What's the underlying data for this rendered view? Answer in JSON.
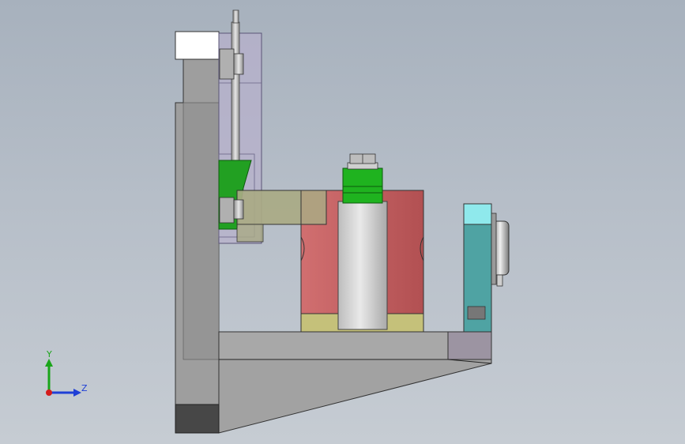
{
  "view": {
    "background_top": "#a7b1bd",
    "background_bottom": "#c6ccd3"
  },
  "triad": {
    "y_label": "Y",
    "z_label": "Z",
    "y_color": "#1aa51a",
    "z_color": "#1f3fd6",
    "x_color": "#d41c1c"
  },
  "parts": {
    "frame_color": "#9e9e9e",
    "plate_color": "#b7b0cc",
    "clamp_color": "#22a022",
    "arm_color": "#a9aa84",
    "drum_color": "#c05a5c",
    "ring_color": "#c5c17a",
    "cylinder_color": "#d6d6d6",
    "gauge_color": "#4fa3a3",
    "gauge_top_color": "#8fe9ec",
    "foot_color": "#474747"
  }
}
